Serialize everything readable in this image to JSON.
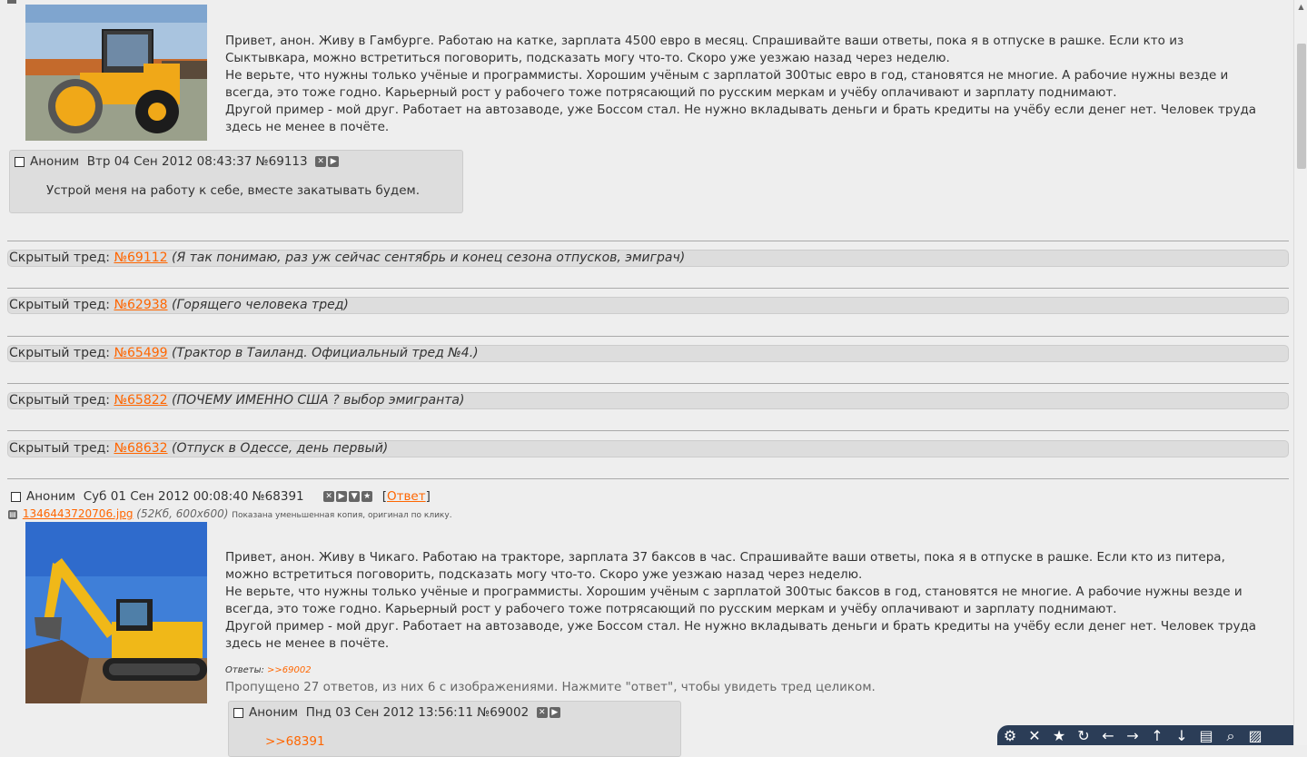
{
  "post1": {
    "paragraphs": [
      "Привет, анон. Живу в Гамбурге. Работаю на катке, зарплата 4500 евро в месяц. Спрашивайте ваши ответы, пока я в отпуске в рашке. Если кто из Сыктывкара, можно встретиться поговорить, подсказать могу что-то. Скоро уже уезжаю назад через неделю.",
      "Не верьте, что нужны только учёные и программисты. Хорошим учёным с зарплатой 300тыс евро в год, становятся не многие. А рабочие нужны везде и всегда, это тоже годно. Карьерный рост у рабочего тоже потрясающий по русским меркам и учёбу оплачивают и зарплату поднимают.",
      "Другой пример - мой друг. Работает на автозаводе, уже Боссом стал. Не нужно вкладывать деньги и брать кредиты на учёбу если денег нет. Человек труда здесь не менее в почёте."
    ]
  },
  "reply1": {
    "author": "Аноним",
    "date": "Втр 04 Сен 2012 08:43:37",
    "num": "№69113",
    "text": "Устрой меня на работу к себе, вместе закатывать будем."
  },
  "hidden_threads": [
    {
      "label": "Скрытый тред:",
      "num": "№69112",
      "title": "(Я так понимаю, раз уж сейчас сентябрь и конец сезона отпусков, эмиграч)"
    },
    {
      "label": "Скрытый тред:",
      "num": "№62938",
      "title": "(Горящего человека тред)"
    },
    {
      "label": "Скрытый тред:",
      "num": "№65499",
      "title": "(Трактор в Таиланд. Официальный тред №4.)"
    },
    {
      "label": "Скрытый тред:",
      "num": "№65822",
      "title": "(ПОЧЕМУ ИМЕННО США ? выбор эмигранта)"
    },
    {
      "label": "Скрытый тред:",
      "num": "№68632",
      "title": "(Отпуск в Одессе, день первый)"
    }
  ],
  "post2": {
    "author": "Аноним",
    "date": "Суб 01 Сен 2012 00:08:40",
    "num": "№68391",
    "reply_open": "[",
    "reply_link": "Ответ",
    "reply_close": "]",
    "file_name": "1346443720706.jpg",
    "file_info": "(52Кб, 600x600)",
    "file_note": "Показана уменьшенная копия, оригинал по клику.",
    "paragraphs": [
      "Привет, анон. Живу в Чикаго. Работаю на тракторе, зарплата 37 баксов в час. Спрашивайте ваши ответы, пока я в отпуске в рашке. Если кто из питера, можно встретиться поговорить, подсказать могу что-то. Скоро уже уезжаю назад через неделю.",
      "Не верьте, что нужны только учёные и программисты. Хорошим учёным с зарплатой 300тыс баксов в год, становятся не многие. А рабочие нужны везде и всегда, это тоже годно. Карьерный рост у рабочего тоже потрясающий по русским меркам и учёбу оплачивают и зарплату поднимают.",
      "Другой пример - мой друг. Работает на автозаводе, уже Боссом стал. Не нужно вкладывать деньги и брать кредиты на учёбу если денег нет. Человек труда здесь не менее в почёте."
    ],
    "answers_label": "Ответы:",
    "answers_link": ">>69002",
    "omitted": "Пропущено 27 ответов, из них 6 с изображениями. Нажмите \"ответ\", чтобы увидеть тред целиком."
  },
  "reply2": {
    "author": "Аноним",
    "date": "Пнд 03 Сен 2012 13:56:11",
    "num": "№69002",
    "quote": ">>68391"
  },
  "toolbar": {
    "icons": [
      "settings-icon",
      "close-icon",
      "star-icon",
      "refresh-icon",
      "arrow-left-icon",
      "arrow-right-icon",
      "arrow-up-icon",
      "arrow-down-icon",
      "folder-icon",
      "zoom-icon",
      "stripes-icon"
    ]
  },
  "colors": {
    "link": "#ff6600",
    "background": "#eeeeee",
    "post_box": "#dddddd",
    "toolbar": "#2b3d57"
  }
}
